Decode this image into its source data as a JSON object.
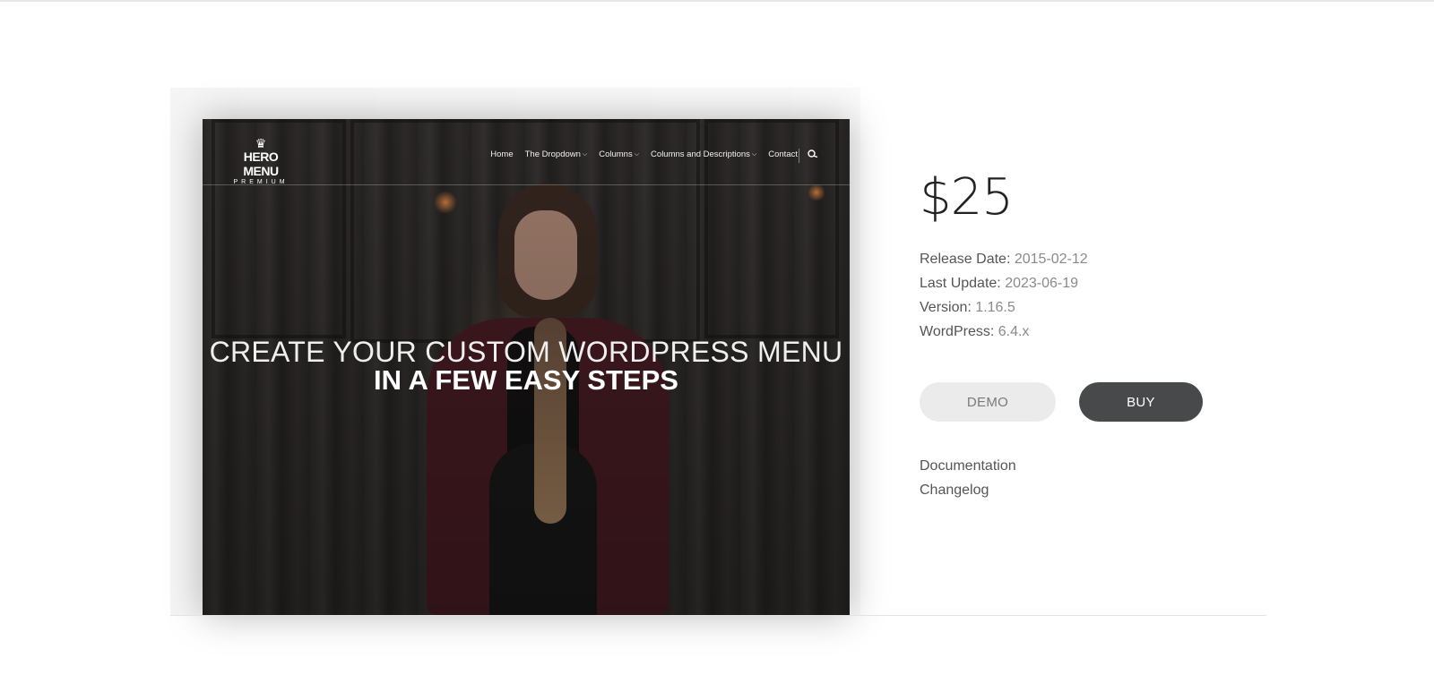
{
  "preview": {
    "logo": {
      "main": "HERO MENU",
      "sub": "PREMIUM"
    },
    "nav": [
      {
        "label": "Home",
        "dropdown": false
      },
      {
        "label": "The Dropdown",
        "dropdown": true
      },
      {
        "label": "Columns",
        "dropdown": true
      },
      {
        "label": "Columns and Descriptions",
        "dropdown": true
      },
      {
        "label": "Contact",
        "dropdown": false
      }
    ],
    "headline_line1": "CREATE YOUR CUSTOM WORDPRESS MENU",
    "headline_line2": "IN A FEW EASY STEPS"
  },
  "product": {
    "price": "$25",
    "meta": [
      {
        "label": "Release Date:",
        "value": "2015-02-12"
      },
      {
        "label": "Last Update:",
        "value": "2023-06-19"
      },
      {
        "label": "Version:",
        "value": "1.16.5"
      },
      {
        "label": "WordPress:",
        "value": "6.4.x"
      }
    ],
    "buttons": {
      "demo": "DEMO",
      "buy": "BUY"
    },
    "links": {
      "documentation": "Documentation",
      "changelog": "Changelog"
    }
  },
  "colors": {
    "buy_button": "#48494b",
    "demo_button": "#ebebeb",
    "cardigan": "#4a1d24"
  }
}
